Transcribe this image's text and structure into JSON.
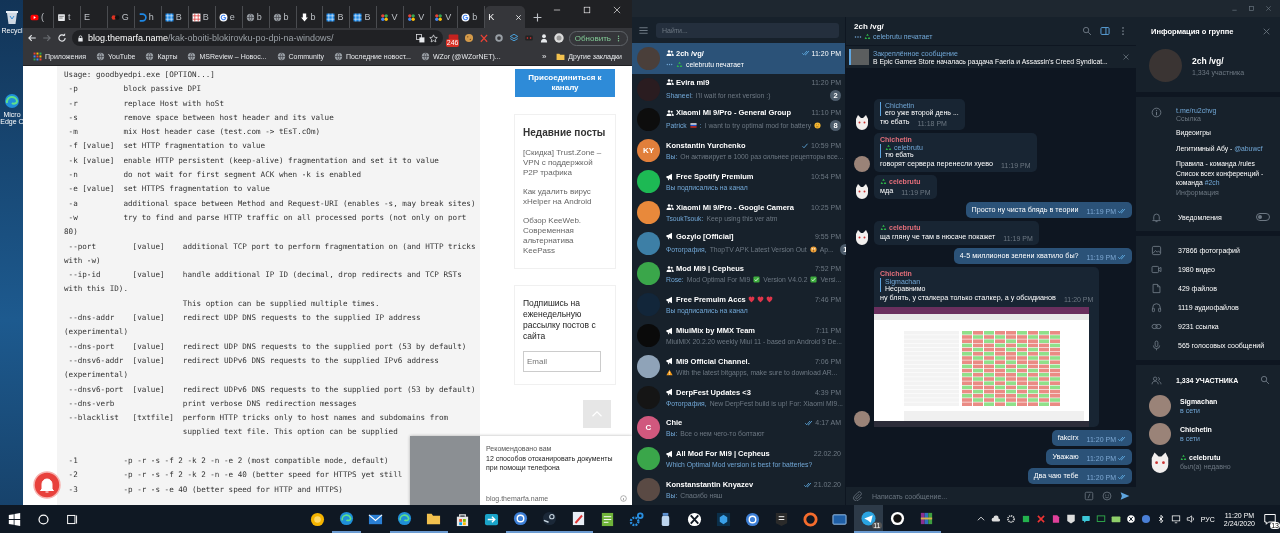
{
  "desktop": {
    "icons": [
      {
        "kind": "bin",
        "label": "Recycl"
      },
      {
        "kind": "swirl",
        "label": "Micro\nEdge C"
      }
    ]
  },
  "browser": {
    "tabs": [
      {
        "kind": "play",
        "title": "(",
        "selected": false
      },
      {
        "kind": "doc",
        "title": "t",
        "selected": false
      },
      {
        "kind": "none",
        "title": "E",
        "selected": false
      },
      {
        "kind": "dot",
        "title": "G",
        "selected": false
      },
      {
        "kind": "hook",
        "title": "h",
        "selected": false
      },
      {
        "kind": "grid",
        "title": "B",
        "selected": false
      },
      {
        "kind": "gridred",
        "title": "B",
        "selected": false
      },
      {
        "kind": "g",
        "title": "e",
        "selected": false
      },
      {
        "kind": "globe",
        "title": "b",
        "selected": false
      },
      {
        "kind": "globe",
        "title": "b",
        "selected": false
      },
      {
        "kind": "arrow",
        "title": "b",
        "selected": false
      },
      {
        "kind": "grid",
        "title": "B",
        "selected": false
      },
      {
        "kind": "grid",
        "title": "B",
        "selected": false
      },
      {
        "kind": "dots",
        "title": "V",
        "selected": false
      },
      {
        "kind": "dots",
        "title": "V",
        "selected": false
      },
      {
        "kind": "dots",
        "title": "V",
        "selected": false
      },
      {
        "kind": "g",
        "title": "b",
        "selected": false
      },
      {
        "kind": "none",
        "title": "K",
        "selected": true
      }
    ],
    "url_host": "blog.themarfa.name",
    "url_path": "/kak-oboiti-blokirovku-po-dpi-na-windows/",
    "extension_badge": "246",
    "update_button": "Обновить",
    "bookmarks": [
      {
        "kind": "apps",
        "label": "Приложения"
      },
      {
        "kind": "globe",
        "label": "YouTube"
      },
      {
        "kind": "globe",
        "label": "Карты"
      },
      {
        "kind": "globe",
        "label": "MSReview – Новос..."
      },
      {
        "kind": "globe",
        "label": "Community"
      },
      {
        "kind": "globe",
        "label": "Последние новост..."
      },
      {
        "kind": "globe",
        "label": "WZor (@WZorNET)..."
      }
    ],
    "bookmarks_more": "»",
    "other_bookmarks": "Другие закладки",
    "code_blocks": [
      [
        {
          "text": "Usage: goodbyedpi.exe [OPTION...]"
        },
        {
          "text": " -p          block passive DPI"
        },
        {
          "text": " -r          replace Host with hoSt"
        },
        {
          "text": " -s          remove space between host header and its value"
        },
        {
          "text": " -m          mix Host header case (test.com -> tEsT.cOm)"
        },
        {
          "text": " -f [value]  set HTTP fragmentation to value"
        },
        {
          "text": " -k [value]  enable HTTP persistent (keep-alive) fragmentation and set it to value"
        },
        {
          "text": " -n          do not wait for first segment ACK when -k is enabled"
        },
        {
          "text": " -e [value]  set HTTPS fragmentation to value"
        },
        {
          "text": " -a          additional space between Method and Request-URI (enables -s, may break sites)"
        },
        {
          "text": " -w          try to find and parse HTTP traffic on all processed ports (not only on port"
        },
        {
          "text": "80)"
        },
        {
          "text": " --port        [value]    additional TCP port to perform fragmentation on (and HTTP tricks"
        },
        {
          "text": "with -w)"
        },
        {
          "text": " --ip-id       [value]    handle additional IP ID (decimal, drop redirects and TCP RSTs"
        },
        {
          "text": "with this ID)."
        },
        {
          "text": "                          This option can be supplied multiple times."
        },
        {
          "text": " --dns-addr    [value]    redirect UDP DNS requests to the supplied IP address"
        },
        {
          "text": "(experimental)"
        },
        {
          "text": " --dns-port    [value]    redirect UDP DNS requests to the supplied port (53 by default)"
        },
        {
          "text": " --dnsv6-addr  [value]    redirect UDPv6 DNS requests to the supplied IPv6 address"
        },
        {
          "text": "(experimental)"
        },
        {
          "text": " --dnsv6-port  [value]    redirect UDPv6 DNS requests to the supplied port (53 by default)"
        },
        {
          "text": " --dns-verb               print verbose DNS redirection messages"
        },
        {
          "text": " --blacklist   [txtfile]  perform HTTP tricks only to host names and subdomains from"
        },
        {
          "text": "                          supplied text file. This option can be supplied"
        }
      ],
      [
        {
          "text": " -1          -p -r -s -f 2 -k 2 -n -e 2 (most compatible mode, default)"
        },
        {
          "text": " -2          -p -r -s -f 2 -k 2 -n -e 40 (better speed for HTTPS yet still"
        },
        {
          "text": " -3          -p -r -s -e 40 (better speed for HTTP and HTTPS)"
        }
      ]
    ],
    "join_button": "Присоединиться к каналу",
    "recent": {
      "title": "Недавние посты",
      "links": [
        "[Скидка] Trust.Zone – VPN с поддержкой P2P трафика",
        "Как удалить вирус xHelper на Android",
        "Обзор KeeWeb. Современная альтернатива KeePass"
      ]
    },
    "subscribe": {
      "text": "Подпишись на еженедельную рассылку постов с сайта",
      "placeholder": "Email"
    },
    "recommendation": {
      "label": "Рекомендовано вам",
      "title": "12 способов отсканировать документы при помощи телефона",
      "source": "blog.themarfa.name"
    }
  },
  "telegram": {
    "search_placeholder": "Найти...",
    "chats": [
      {
        "kind": "group",
        "name": "2ch /vg/",
        "time": "11:20 PM",
        "read": true,
        "selected": true,
        "avatar": {
          "color": "#4a3f3a"
        },
        "preview": [
          {
            "kind": "typing"
          },
          {
            "kind": "recycle"
          },
          {
            "kind": "text",
            "text": "celebrutu печатает"
          }
        ]
      },
      {
        "kind": "group",
        "name": "Evira mi9",
        "time": "11:20 PM",
        "selected": false,
        "unread": "2",
        "avatar": {
          "color": "#2a1c20"
        },
        "preview": [
          {
            "kind": "sender",
            "text": "Shaneel:"
          },
          {
            "kind": "text",
            "text": "I'll wait for next version :)"
          }
        ]
      },
      {
        "kind": "group",
        "name": "Xiaomi Mi 9/Pro - General Group",
        "time": "11:10 PM",
        "selected": false,
        "unread": "8",
        "avatar": {
          "color": "#0d0d0d"
        },
        "preview": [
          {
            "kind": "sender",
            "text": "Patrick"
          },
          {
            "kind": "flag"
          },
          {
            "kind": "sender",
            "text": ":"
          },
          {
            "kind": "text",
            "text": "I want to try optimal mod for battery"
          },
          {
            "kind": "thinking"
          }
        ]
      },
      {
        "kind": "user",
        "name": "Konstantin Yurchenko",
        "time": "10:59 PM",
        "read": false,
        "selected": false,
        "avatar": {
          "color": "#e17f3b",
          "initials": "KY"
        },
        "preview": [
          {
            "kind": "sender",
            "text": "Вы:"
          },
          {
            "kind": "text",
            "text": "Он активирует в 1000 раз сильнее рецепторы все..."
          }
        ]
      },
      {
        "kind": "channel",
        "name": "Free Spotify Premium",
        "time": "10:54 PM",
        "selected": false,
        "avatar": {
          "color": "#1db954"
        },
        "preview": [
          {
            "kind": "service",
            "text": "Вы подписались на канал"
          }
        ]
      },
      {
        "kind": "group",
        "name": "Xiaomi Mi 9/Pro - Google Camera",
        "time": "10:25 PM",
        "selected": false,
        "avatar": {
          "color": "#e8893b"
        },
        "preview": [
          {
            "kind": "sender",
            "text": "TsoukTsouk:"
          },
          {
            "kind": "text",
            "text": "Keep using this ver atm"
          }
        ]
      },
      {
        "kind": "channel",
        "name": "Gozylo [Official]",
        "time": "9:55 PM",
        "selected": false,
        "unread": "1",
        "avatar": {
          "color": "#3d7fa6"
        },
        "preview": [
          {
            "kind": "sender",
            "text": "Фотография,"
          },
          {
            "kind": "text",
            "text": "ThopTV APK Latest Version Out"
          },
          {
            "kind": "flushed"
          },
          {
            "kind": "text",
            "text": "Ap..."
          }
        ]
      },
      {
        "kind": "group",
        "name": "Mod Mi9 | Cepheus",
        "time": "7:52 PM",
        "selected": false,
        "avatar": {
          "color": "#3aa64a"
        },
        "preview": [
          {
            "kind": "sender",
            "text": "Rose:"
          },
          {
            "kind": "text",
            "text": "Mod Optimal For Mi9"
          },
          {
            "kind": "checkmark"
          },
          {
            "kind": "text",
            "text": "Version V4.0.2"
          },
          {
            "kind": "checkmark"
          },
          {
            "kind": "text",
            "text": "Versi..."
          }
        ]
      },
      {
        "kind": "channel",
        "name": "Free Premuim Accs",
        "name_emoji": [
          {
            "kind": "heart"
          },
          {
            "kind": "heart"
          },
          {
            "kind": "heart"
          }
        ],
        "time": "7:46 PM",
        "selected": false,
        "avatar": {
          "color": "#12263a"
        },
        "preview": [
          {
            "kind": "service",
            "text": "Вы подписались на канал"
          }
        ]
      },
      {
        "kind": "channel",
        "name": "MiuiMix by MMX Team",
        "time": "7:11 PM",
        "selected": false,
        "avatar": {
          "color": "#0a0a0a"
        },
        "preview": [
          {
            "kind": "text",
            "text": "MiuiMIX 20.2.20 weekly Miui 11 - based on Android 9 De..."
          }
        ]
      },
      {
        "kind": "channel",
        "name": "Mi9 Official Channel.",
        "time": "7:06 PM",
        "selected": false,
        "avatar": {
          "color": "#8fa3b8"
        },
        "preview": [
          {
            "kind": "warning"
          },
          {
            "kind": "text",
            "text": "With the latest bitgapps, make sure to download AR..."
          }
        ]
      },
      {
        "kind": "channel",
        "name": "DerpFest Updates <3",
        "time": "4:39 PM",
        "selected": false,
        "avatar": {
          "color": "#151515"
        },
        "preview": [
          {
            "kind": "sender",
            "text": "Фотография,"
          },
          {
            "kind": "text",
            "text": "New DerpFest build is up!  For: Xiaomi MI9..."
          }
        ]
      },
      {
        "kind": "user",
        "name": "Chie",
        "time": "4:17 AM",
        "read": true,
        "selected": false,
        "avatar": {
          "color": "#d0587e",
          "initials": "C"
        },
        "preview": [
          {
            "kind": "sender",
            "text": "Вы:"
          },
          {
            "kind": "text",
            "text": "Все о нем чего-то болтают"
          }
        ]
      },
      {
        "kind": "channel",
        "name": "All Mod For Mi9 | Cepheus",
        "time": "22.02.20",
        "selected": false,
        "avatar": {
          "color": "#3aa64a"
        },
        "preview": [
          {
            "kind": "service",
            "text": "Which Optimal Mod version is best for batteries?"
          }
        ]
      },
      {
        "kind": "user",
        "name": "Konstanstantin Knyazev",
        "time": "21.02.20",
        "read": true,
        "selected": false,
        "avatar": {
          "color": "#5a4a44"
        },
        "preview": [
          {
            "kind": "sender",
            "text": "Вы:"
          },
          {
            "kind": "text",
            "text": "Спасибо няш"
          }
        ]
      }
    ],
    "chat": {
      "title": "2ch /vg/",
      "typing": true,
      "status_badge": true,
      "status": "celebrutu печатает",
      "pinned": {
        "label": "Закреплённое сообщение",
        "text": "В Epic Games Store началась раздача Faeria и Assassin's Creed Syndicat..."
      },
      "messages": [
        {
          "outgoing": false,
          "reply": {
            "author": "Chichetin",
            "text": "его уже второй день ..."
          },
          "text": "тю ебать",
          "time": "11:18 PM",
          "avatar": {
            "kind": "cat"
          }
        },
        {
          "outgoing": false,
          "author": "Chichetin",
          "reply": {
            "author": "celebrutu",
            "author_badge": true,
            "text": "тю ебать"
          },
          "text": "говорят сервера перенесли хуево",
          "time": "11:19 PM",
          "avatar": {
            "kind": "photo"
          }
        },
        {
          "outgoing": false,
          "author": "celebrutu",
          "author_badge": true,
          "text": "мда",
          "time": "11:19 PM",
          "avatar": {
            "kind": "cat"
          }
        },
        {
          "outgoing": true,
          "text": "Просто ну чиста блядь в теории",
          "time": "11:19 PM",
          "read": true
        },
        {
          "outgoing": false,
          "author": "celebrutu",
          "author_badge": true,
          "text": "ща гляну че там в нюсаче покажет",
          "time": "11:19 PM",
          "avatar": {
            "kind": "cat"
          }
        },
        {
          "outgoing": true,
          "text": "4-5 миллионов зелени хватило бы?",
          "time": "11:19 PM",
          "read": true
        },
        {
          "outgoing": false,
          "author": "Chichetin",
          "reply": {
            "author": "Sigmachan",
            "text": "Несравнимо"
          },
          "text": "ну блять, у сталкера только сталкер, а у обсидианов",
          "time": "11:20 PM",
          "image": true,
          "avatar": {
            "kind": "photo"
          }
        },
        {
          "outgoing": true,
          "text": "fakcirx",
          "time": "11:20 PM",
          "read": true
        },
        {
          "outgoing": true,
          "text": "Уважаю",
          "time": "11:20 PM",
          "read": true
        },
        {
          "outgoing": true,
          "text": "Два чаю тебе",
          "time": "11:20 PM",
          "read": true
        }
      ],
      "composer_placeholder": "Написать сообщение..."
    },
    "info": {
      "title": "Информация о группе",
      "name": "2ch /vg/",
      "members": "1,334 участника",
      "link": "t.me/ru2chvg",
      "link_label": "Ссылка",
      "description": [
        [
          {
            "text": "Видеоигры"
          }
        ],
        [
          {
            "text": "Легитимный Абу - "
          },
          {
            "text": "@abuwcf",
            "link": true
          }
        ],
        [
          {
            "text": "Правила - команда /rules\nСписок всех конференций - команда "
          },
          {
            "text": "#2ch",
            "link": true
          }
        ]
      ],
      "description_label": "Информация",
      "notifications": {
        "label": "Уведомления",
        "on": false
      },
      "media": [
        {
          "kind": "photo",
          "label": "37866 фотографий"
        },
        {
          "kind": "video",
          "label": "1980 видео"
        },
        {
          "kind": "file",
          "label": "429 файлов"
        },
        {
          "kind": "audio",
          "label": "1119 аудиофайлов"
        },
        {
          "kind": "link",
          "label": "9231 ссылка"
        },
        {
          "kind": "voice",
          "label": "565 голосовых сообщений"
        }
      ],
      "members_header": "1,334 УЧАСТНИКА",
      "member_list": [
        {
          "name": "Sigmachan",
          "status": "в сети",
          "online": true,
          "avatar": {
            "kind": "photo"
          }
        },
        {
          "name": "Chichetin",
          "status": "в сети",
          "online": true,
          "avatar": {
            "kind": "photo"
          }
        },
        {
          "name": "celebrutu",
          "author_badge": true,
          "status": "был(а) недавно",
          "online": false,
          "avatar": {
            "kind": "cat"
          }
        }
      ]
    }
  },
  "taskbar": {
    "apps": [
      {
        "kind": "sun",
        "running": false,
        "active": false
      },
      {
        "kind": "swirl",
        "running": true,
        "active": false
      },
      {
        "kind": "mail",
        "running": false,
        "active": false
      },
      {
        "kind": "swirl",
        "running": true,
        "active": false
      },
      {
        "kind": "folder",
        "running": true,
        "active": false
      },
      {
        "kind": "bag",
        "running": false,
        "active": false
      },
      {
        "kind": "arrowbox",
        "running": false,
        "active": false
      },
      {
        "kind": "ring",
        "running": true,
        "active": false
      },
      {
        "kind": "steam",
        "running": true,
        "active": false
      },
      {
        "kind": "pen",
        "running": true,
        "active": false
      },
      {
        "kind": "notes",
        "running": false,
        "active": false
      },
      {
        "kind": "gears",
        "running": false,
        "active": false
      },
      {
        "kind": "jar",
        "running": false,
        "active": false
      },
      {
        "kind": "xbox",
        "running": false,
        "active": false
      },
      {
        "kind": "cube",
        "running": false,
        "active": false
      },
      {
        "kind": "ring",
        "running": false,
        "active": false
      },
      {
        "kind": "shield",
        "running": false,
        "active": false
      },
      {
        "kind": "orange",
        "running": false,
        "active": false
      },
      {
        "kind": "square",
        "running": false,
        "active": false
      },
      {
        "kind": "plane",
        "running": true,
        "active": true,
        "badge": "11"
      },
      {
        "kind": "dark",
        "running": true,
        "active": false
      },
      {
        "kind": "books",
        "running": true,
        "active": false
      }
    ],
    "language": "РУС",
    "time": "11:20 PM",
    "date": "2/24/2020",
    "notifications": "13"
  }
}
